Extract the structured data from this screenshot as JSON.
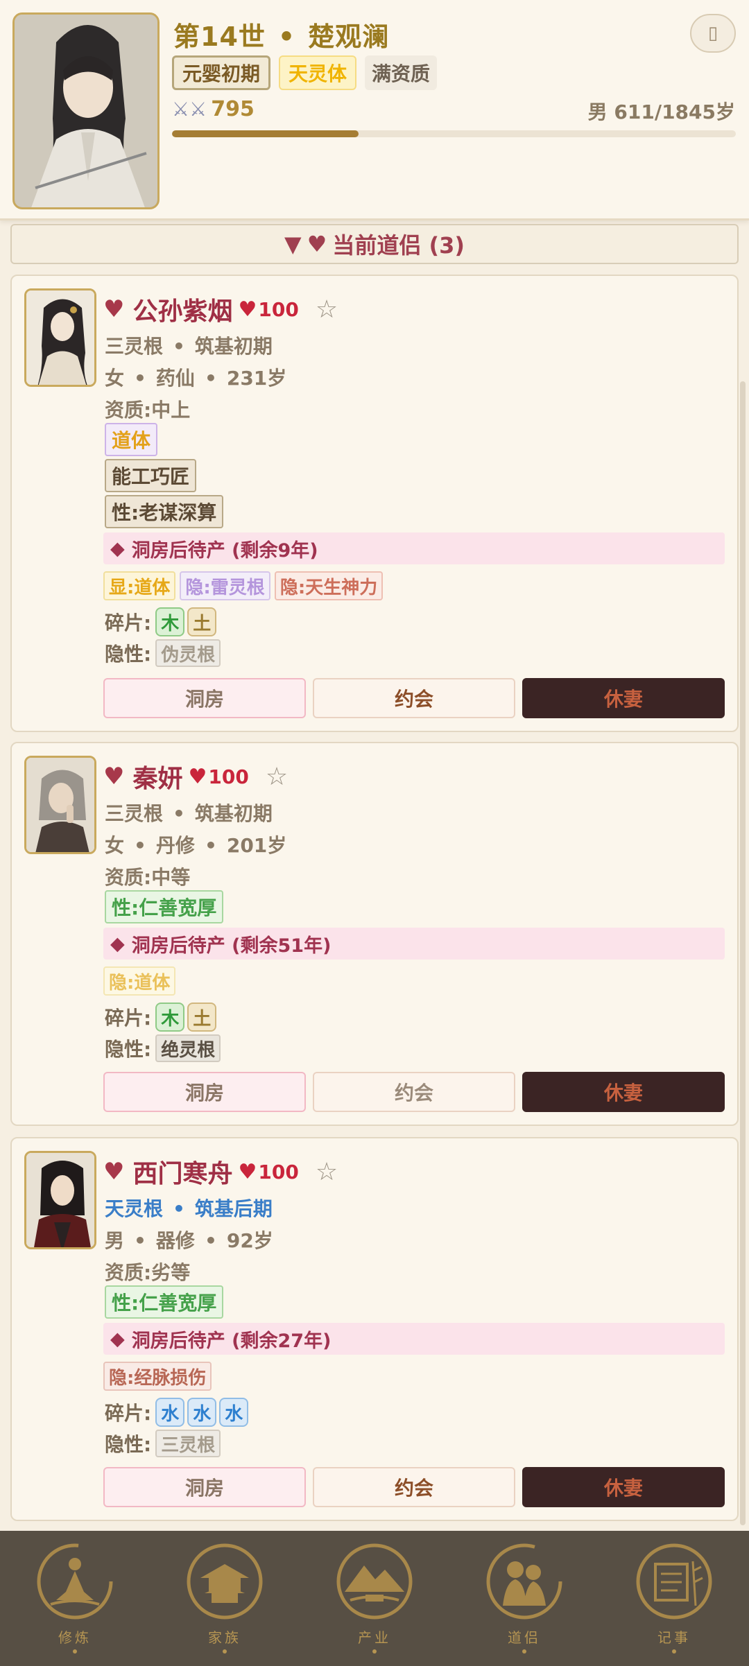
{
  "header": {
    "generation": "第14世",
    "separator": "•",
    "name": "楚观澜",
    "realm": "元婴初期",
    "body_type": "天灵体",
    "aptitude": "满资质",
    "power": "795",
    "age_text": "男 611/1845岁",
    "age_progress": 0.331,
    "menu_icon": "menu-icon"
  },
  "section": {
    "arrow": "▼",
    "heart": "♥",
    "title": "当前道侣 (3)"
  },
  "companions": [
    {
      "heart_icon": "♥",
      "name": "公孙紫烟",
      "affection_heart": "♥",
      "affection": "100",
      "star": "☆",
      "root": "三灵根",
      "realm": "筑基初期",
      "gender": "女",
      "profession": "药仙",
      "age": "231岁",
      "talent": "资质:中上",
      "body_tag": "道体",
      "skill_tag": "能工巧匠",
      "trait_tag": "性:老谋深算",
      "pending_icon": "◆",
      "pending": "洞房后待产 (剩余9年)",
      "genes": [
        "显:道体",
        "隐:雷灵根",
        "隐:天生神力"
      ],
      "fragments_label": "碎片:",
      "fragments": [
        "木",
        "土"
      ],
      "recessive_label": "隐性:",
      "recessive": "伪灵根",
      "buttons": {
        "bridal": "洞房",
        "date": "约会",
        "divorce": "休妻"
      }
    },
    {
      "heart_icon": "♥",
      "name": "秦妍",
      "affection_heart": "♥",
      "affection": "100",
      "star": "☆",
      "root": "三灵根",
      "realm": "筑基初期",
      "gender": "女",
      "profession": "丹修",
      "age": "201岁",
      "talent": "资质:中等",
      "trait_tag": "性:仁善宽厚",
      "pending_icon": "◆",
      "pending": "洞房后待产 (剩余51年)",
      "genes": [
        "隐:道体"
      ],
      "fragments_label": "碎片:",
      "fragments": [
        "木",
        "土"
      ],
      "recessive_label": "隐性:",
      "recessive": "绝灵根",
      "buttons": {
        "bridal": "洞房",
        "date": "约会",
        "divorce": "休妻"
      }
    },
    {
      "heart_icon": "♥",
      "name": "西门寒舟",
      "affection_heart": "♥",
      "affection": "100",
      "star": "☆",
      "root": "天灵根",
      "realm": "筑基后期",
      "gender": "男",
      "profession": "器修",
      "age": "92岁",
      "talent": "资质:劣等",
      "trait_tag": "性:仁善宽厚",
      "pending_icon": "◆",
      "pending": "洞房后待产 (剩余27年)",
      "genes": [
        "隐:经脉损伤"
      ],
      "fragments_label": "碎片:",
      "fragments": [
        "水",
        "水",
        "水"
      ],
      "recessive_label": "隐性:",
      "recessive": "三灵根",
      "buttons": {
        "bridal": "洞房",
        "date": "约会",
        "divorce": "休妻"
      }
    }
  ],
  "nav": [
    {
      "label": "修炼",
      "icon": "meditation-icon"
    },
    {
      "label": "家族",
      "icon": "pavilion-icon"
    },
    {
      "label": "产业",
      "icon": "mountain-icon"
    },
    {
      "label": "道侣",
      "icon": "couple-icon"
    },
    {
      "label": "记事",
      "icon": "scroll-icon"
    }
  ]
}
